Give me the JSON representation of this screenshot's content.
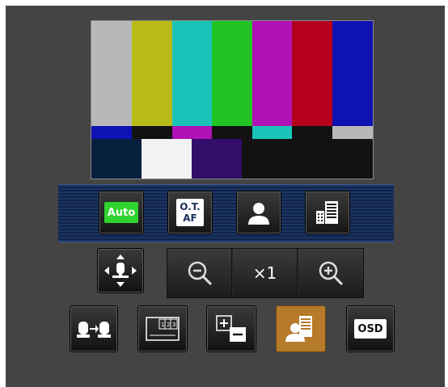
{
  "toolbar": {
    "auto_label": "Auto",
    "ot_af_line1": "O.T.",
    "ot_af_line2": "AF"
  },
  "zoom": {
    "level_label": "×1"
  },
  "bottom": {
    "osd_label": "OSD",
    "active_color": "#b57a2a"
  },
  "preview": {
    "colors_main": [
      "#b8b8b8",
      "#b8bb17",
      "#1bc3b9",
      "#22c423",
      "#b011b6",
      "#b5001c",
      "#0f12b2"
    ],
    "colors_mid": [
      "#0f12b2",
      "#121212",
      "#b011b6",
      "#121212",
      "#1bc3b9",
      "#121212",
      "#b8b8b8"
    ],
    "colors_low": [
      "#06203e",
      "#f2f2f2",
      "#320d6a",
      "#121212",
      "#121212",
      "#121212",
      "#121212"
    ]
  },
  "icons": [
    "auto-focus-icon",
    "ot-af-icon",
    "person-icon",
    "building-icon",
    "pan-tilt-icon",
    "zoom-out-icon",
    "zoom-in-icon",
    "camera-transfer-icon",
    "split-screen-icon",
    "plus-minus-icon",
    "person-scene-icon",
    "osd-icon"
  ]
}
